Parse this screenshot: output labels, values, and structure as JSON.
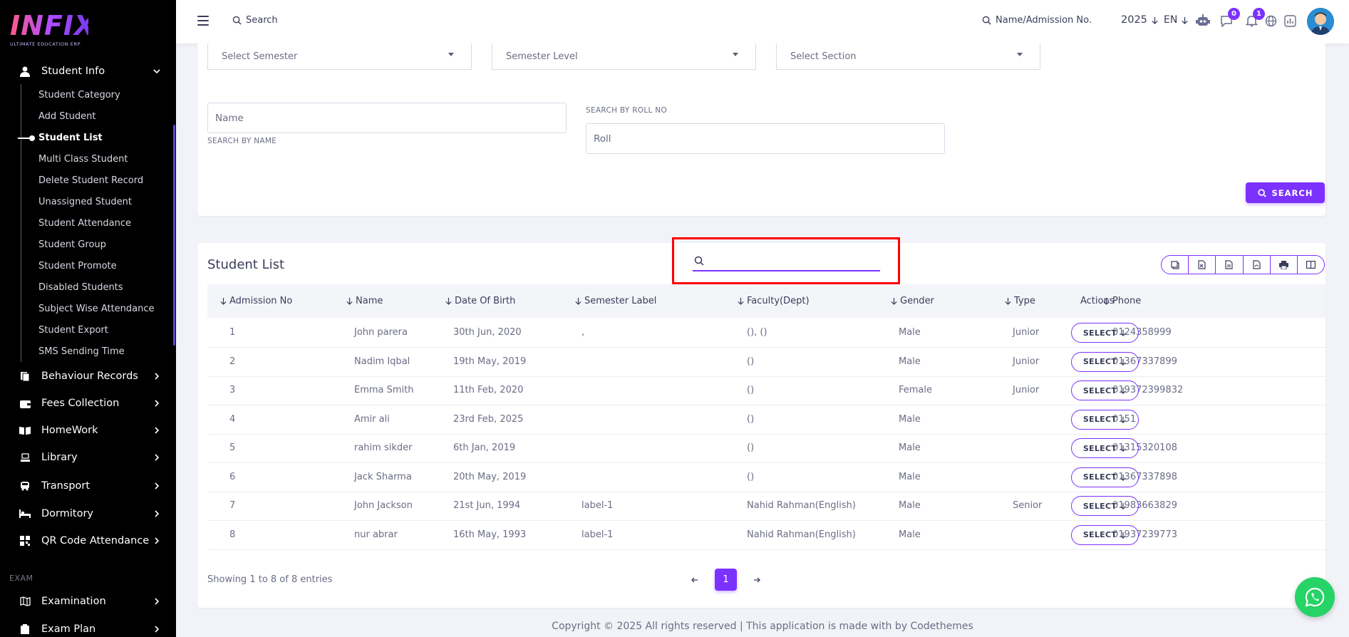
{
  "brand": {
    "logo_text": "INFIX",
    "logo_sub": "ULTIMATE EDUCATION ERP"
  },
  "sidebar": {
    "student_info": "Student Info",
    "sub_items": [
      "Student Category",
      "Add Student",
      "Student List",
      "Multi Class Student",
      "Delete Student Record",
      "Unassigned Student",
      "Student Attendance",
      "Student Group",
      "Student Promote",
      "Disabled Students",
      "Subject Wise Attendance",
      "Student Export",
      "SMS Sending Time"
    ],
    "active_sub": "Student List",
    "modules": [
      "Behaviour Records",
      "Fees Collection",
      "HomeWork",
      "Library",
      "Transport",
      "Dormitory",
      "QR Code Attendance"
    ],
    "section_exam": "EXAM",
    "exam_modules": [
      "Examination",
      "Exam Plan"
    ]
  },
  "topbar": {
    "search_label": "Search",
    "admission_search": "Name/Admission No.",
    "year": "2025",
    "lang": "EN",
    "chat_badge": "0",
    "notif_badge": "1"
  },
  "filters": {
    "semester_placeholder": "Select Semester",
    "semester_level_placeholder": "Semester Level",
    "section_placeholder": "Select Section",
    "name_placeholder": "Name",
    "name_label": "SEARCH BY NAME",
    "roll_label": "SEARCH BY ROLL NO",
    "roll_placeholder": "Roll",
    "search_button": "SEARCH"
  },
  "student_list": {
    "title": "Student List",
    "search_value": "",
    "columns": [
      "Admission No",
      "Name",
      "Date Of Birth",
      "Semester Label",
      "Faculty(Dept)",
      "Gender",
      "Type",
      "Phone",
      "Actions"
    ],
    "rows": [
      {
        "admission": "1",
        "name": "John parera",
        "dob": "30th Jun, 2020",
        "semester": ",",
        "faculty": "(), ()",
        "gender": "Male",
        "type": "Junior",
        "phone": "0124358999"
      },
      {
        "admission": "2",
        "name": "Nadim Iqbal",
        "dob": "19th May, 2019",
        "semester": "",
        "faculty": "()",
        "gender": "Male",
        "type": "Junior",
        "phone": "01367337899"
      },
      {
        "admission": "3",
        "name": "Emma Smith",
        "dob": "11th Feb, 2020",
        "semester": "",
        "faculty": "()",
        "gender": "Female",
        "type": "Junior",
        "phone": "019372399832"
      },
      {
        "admission": "4",
        "name": "Amir ali",
        "dob": "23rd Feb, 2025",
        "semester": "",
        "faculty": "()",
        "gender": "Male",
        "type": "",
        "phone": "0151"
      },
      {
        "admission": "5",
        "name": "rahim sikder",
        "dob": "6th Jan, 2019",
        "semester": "",
        "faculty": "()",
        "gender": "Male",
        "type": "",
        "phone": "01315320108"
      },
      {
        "admission": "6",
        "name": "Jack Sharma",
        "dob": "20th May, 2019",
        "semester": "",
        "faculty": "()",
        "gender": "Male",
        "type": "",
        "phone": "01367337898"
      },
      {
        "admission": "7",
        "name": "John Jackson",
        "dob": "21st Jun, 1994",
        "semester": "label-1",
        "faculty": "Nahid Rahman(English)",
        "gender": "Male",
        "type": "Senior",
        "phone": "01983663829"
      },
      {
        "admission": "8",
        "name": "nur abrar",
        "dob": "16th May, 1993",
        "semester": "label-1",
        "faculty": "Nahid Rahman(English)",
        "gender": "Male",
        "type": "",
        "phone": "01937239773"
      }
    ],
    "select_label": "SELECT",
    "showing": "Showing 1 to 8 of 8 entries",
    "current_page": "1"
  },
  "footer": "Copyright © 2025 All rights reserved | This application is made with by Codethemes",
  "colors": {
    "accent": "#7c32ff",
    "sidebar_bg": "#000000",
    "highlight": "#ff0000",
    "whatsapp": "#25d366"
  }
}
